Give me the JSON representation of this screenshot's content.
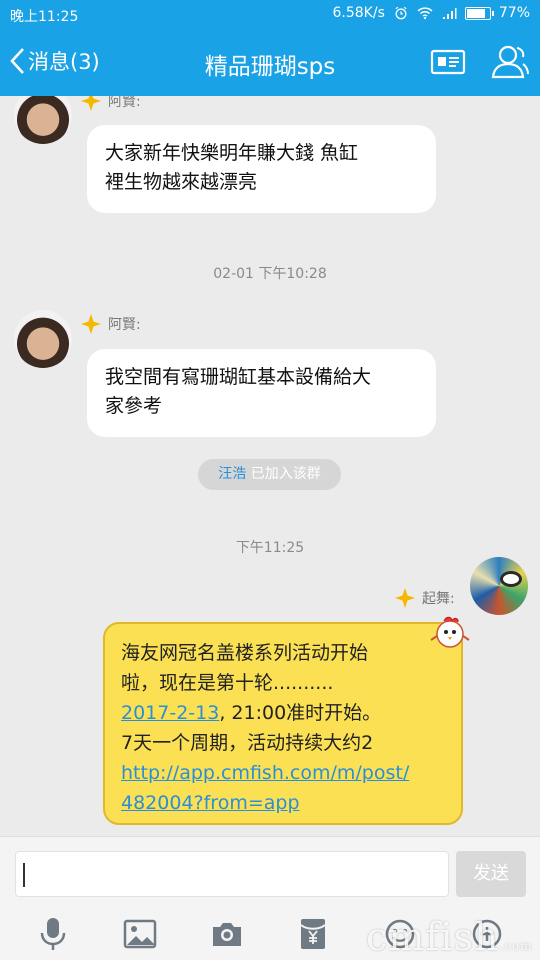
{
  "status_bar": {
    "time": "晚上11:25",
    "network_speed": "6.58K/s",
    "battery": "77%",
    "battery_level": 0.77
  },
  "nav": {
    "back_label": "消息(3)",
    "title": "精品珊瑚sps"
  },
  "messages": [
    {
      "sender": "阿賢:",
      "lines": [
        "大家新年快樂明年賺大錢  魚缸",
        "裡生物越來越漂亮"
      ]
    },
    {
      "timestamp": "02-01 下午10:28"
    },
    {
      "sender": "阿賢:",
      "lines": [
        "我空間有寫珊瑚缸基本設備給大",
        "家參考"
      ]
    },
    {
      "system": {
        "name": "汪浩",
        "text": " 已加入该群"
      }
    },
    {
      "timestamp": "下午11:25"
    },
    {
      "sender": "起舞:",
      "line1": "海友网冠名盖楼系列活动开始",
      "line2": "啦，现在是第十轮..........",
      "line3_link": "2017-2-13",
      "line3_rest": ", 21:00准时开始。",
      "line4": "7天一个周期，活动持续大约2",
      "url_line1": "http://app.cmfish.com/m/post/",
      "url_line2": "482004?from=app"
    }
  ],
  "input": {
    "send_label": "发送"
  },
  "toolbar": [
    "mic-icon",
    "image-icon",
    "camera-icon",
    "red-packet-icon",
    "emoji-icon",
    "plus-icon"
  ],
  "watermark": {
    "main": "cmfish",
    "suffix": ".com"
  }
}
